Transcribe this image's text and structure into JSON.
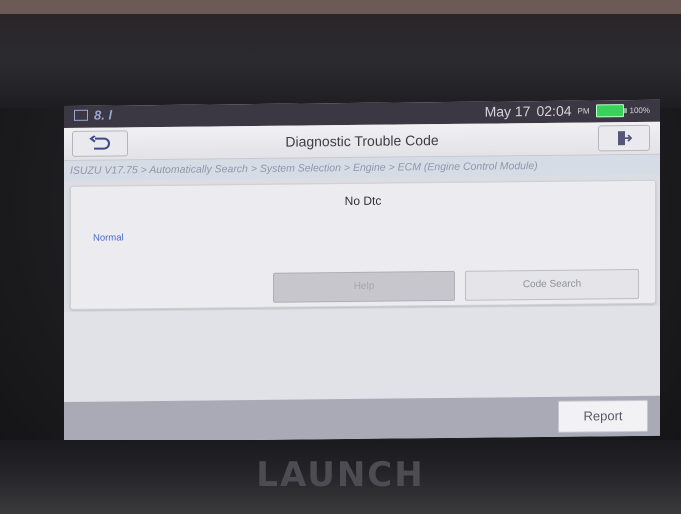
{
  "status_bar": {
    "signal_text": "8. l",
    "date": "May 17",
    "time": "02:04",
    "time_suffix": "PM",
    "battery": "100%"
  },
  "header": {
    "title": "Diagnostic Trouble Code"
  },
  "breadcrumb": "ISUZU V17.75 > Automatically Search > System Selection > Engine > ECM (Engine Control Module)",
  "result": {
    "message": "No Dtc",
    "status": "Normal"
  },
  "buttons": {
    "help": "Help",
    "code_search": "Code Search",
    "report": "Report"
  },
  "device": {
    "brand": "LAUNCH"
  },
  "colors": {
    "status_bar_bg": "#3b3844",
    "battery": "#39d25b",
    "status_link": "#4b67c9",
    "bottom_bar": "#a9aab6"
  }
}
